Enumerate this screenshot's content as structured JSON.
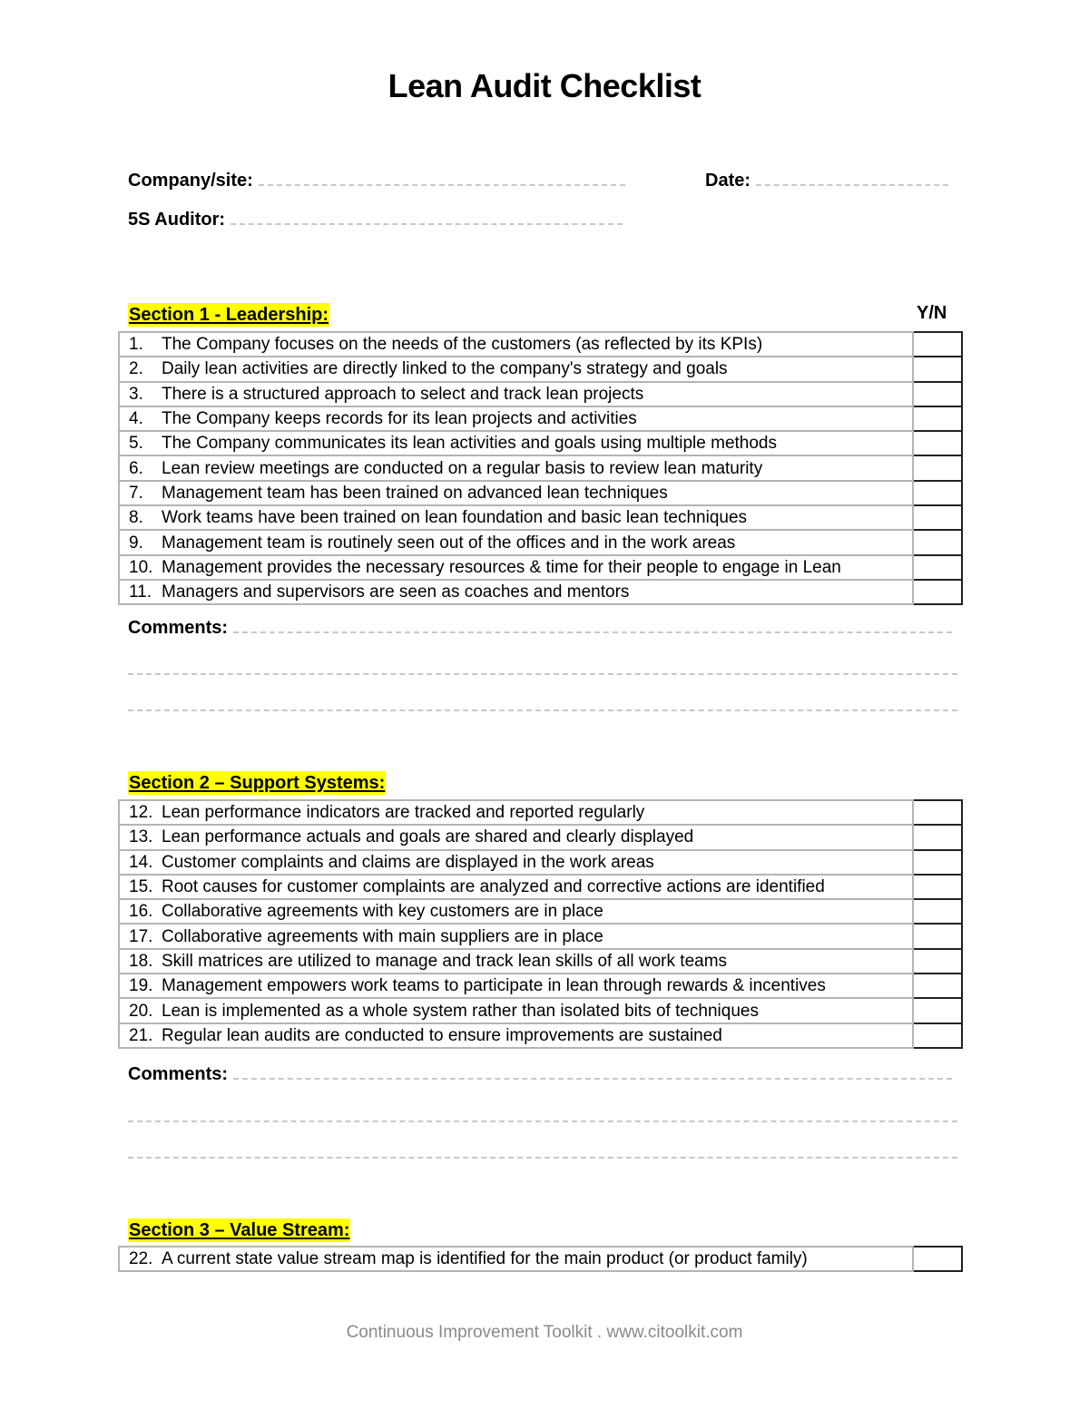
{
  "document": {
    "title": "Lean Audit Checklist",
    "fields": {
      "company_label": "Company/site:",
      "date_label": "Date:",
      "auditor_label": "5S Auditor:"
    },
    "yn_label": "Y/N",
    "comments_label": "Comments:",
    "sections": [
      {
        "heading": "Section 1 - Leadership:",
        "items": [
          {
            "num": "1.",
            "text": "The Company focuses on the needs of the customers (as reflected by its KPIs)"
          },
          {
            "num": "2.",
            "text": "Daily lean activities are directly linked to the company's strategy and goals"
          },
          {
            "num": "3.",
            "text": "There is a structured approach to select and track lean projects"
          },
          {
            "num": "4.",
            "text": "The Company keeps records for its lean projects and activities"
          },
          {
            "num": "5.",
            "text": "The Company communicates its lean activities and goals using multiple methods"
          },
          {
            "num": "6.",
            "text": "Lean review meetings are conducted on a regular basis to review lean maturity"
          },
          {
            "num": "7.",
            "text": "Management team has been trained on advanced lean techniques"
          },
          {
            "num": "8.",
            "text": "Work teams have been trained on lean foundation and basic lean techniques"
          },
          {
            "num": "9.",
            "text": "Management team is routinely seen out of the offices and in the work areas"
          },
          {
            "num": "10.",
            "text": "Management provides the necessary resources & time for their people to engage in Lean"
          },
          {
            "num": "11.",
            "text": "Managers and supervisors are seen as  coaches and mentors"
          }
        ]
      },
      {
        "heading": "Section 2 – Support Systems:",
        "items": [
          {
            "num": "12.",
            "text": "Lean performance indicators are tracked and reported regularly"
          },
          {
            "num": "13.",
            "text": "Lean performance actuals and goals are shared and clearly displayed"
          },
          {
            "num": "14.",
            "text": "Customer complaints and claims are displayed in the work areas"
          },
          {
            "num": "15.",
            "text": "Root causes for customer complaints are analyzed and corrective actions are identified"
          },
          {
            "num": "16.",
            "text": "Collaborative agreements with key customers are in place"
          },
          {
            "num": "17.",
            "text": "Collaborative agreements with main suppliers are in place"
          },
          {
            "num": "18.",
            "text": "Skill matrices are utilized to manage and track lean skills of all work teams"
          },
          {
            "num": "19.",
            "text": "Management empowers work teams to participate in lean through rewards & incentives"
          },
          {
            "num": "20.",
            "text": "Lean is implemented as a whole system rather than isolated bits of techniques"
          },
          {
            "num": "21.",
            "text": "Regular lean audits are conducted to ensure improvements are sustained"
          }
        ]
      },
      {
        "heading": "Section 3 – Value Stream:",
        "items": [
          {
            "num": "22.",
            "text": "A current state value stream map is identified for the main product (or product family)"
          }
        ]
      }
    ],
    "footer": "Continuous Improvement Toolkit . www.citoolkit.com"
  }
}
